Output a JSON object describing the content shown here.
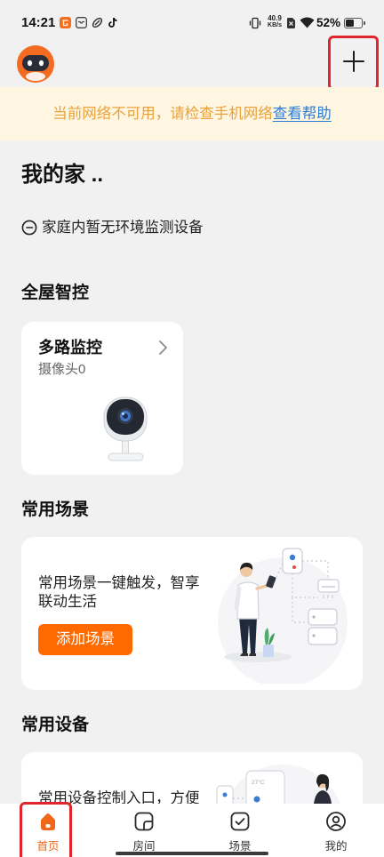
{
  "status_bar": {
    "time": "14:21",
    "notification_icons": [
      "shopping-app-icon",
      "inbox-app-icon",
      "link-app-icon",
      "tiktok-icon"
    ],
    "system_icons": [
      "vibrate-icon",
      "no-sim-icon",
      "wifi-icon",
      "battery-icon"
    ],
    "net_speed_value": "40.9",
    "net_speed_unit": "KB/s",
    "battery_percent": "52%",
    "battery_level": 0.52
  },
  "header": {
    "avatar_icon": "robot-avatar-icon",
    "add_icon": "plus-icon"
  },
  "banner": {
    "message": "当前网络不可用，请检查手机网络",
    "link_label": "查看帮助"
  },
  "home": {
    "title": "我的家 ..",
    "env_icon": "sensor-icon",
    "env_notice": "家庭内暂无环境监测设备"
  },
  "whole_house": {
    "heading": "全屋智控",
    "card": {
      "title": "多路监控",
      "subtitle": "摄像头0",
      "chevron_icon": "chevron-right-icon"
    }
  },
  "scenes": {
    "heading": "常用场景",
    "description": "常用场景一键触发，智享联动生活",
    "button_label": "添加场景"
  },
  "devices": {
    "heading": "常用设备",
    "description": "常用设备控制入口，方便",
    "illustration_temp": "27°C"
  },
  "bottom_nav": {
    "items": [
      {
        "label": "首页",
        "icon": "home-icon",
        "active": true
      },
      {
        "label": "房间",
        "icon": "room-icon",
        "active": false
      },
      {
        "label": "场景",
        "icon": "scene-icon",
        "active": false
      },
      {
        "label": "我的",
        "icon": "profile-icon",
        "active": false
      }
    ]
  },
  "colors": {
    "accent": "#FF6A00",
    "nav_active": "#F2661A",
    "banner_bg": "#FFF6E1",
    "banner_text": "#E9A13B",
    "link": "#2C7DD6",
    "page_bg": "#F1F1F1",
    "highlight": "#E0262C"
  }
}
